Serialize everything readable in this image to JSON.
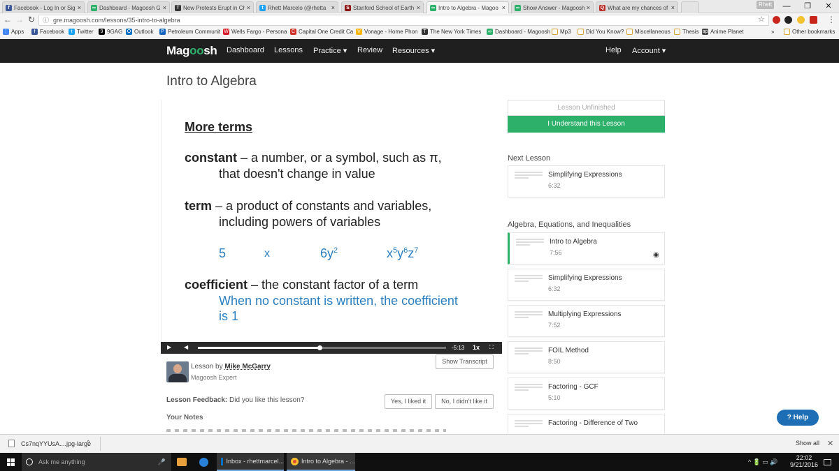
{
  "browser": {
    "tabs": [
      {
        "label": "Facebook - Log In or Sig",
        "color": "#3b5998",
        "glyph": "f"
      },
      {
        "label": "Dashboard - Magoosh G",
        "color": "#2db06a",
        "glyph": "∞"
      },
      {
        "label": "New Protests Erupt in Ch",
        "color": "#333333",
        "glyph": "T"
      },
      {
        "label": "Rhett Marcelo (@rhetta",
        "color": "#1da1f2",
        "glyph": "t"
      },
      {
        "label": "Stanford School of Earth",
        "color": "#8c1515",
        "glyph": "S"
      },
      {
        "label": "Intro to Algebra - Magoo",
        "color": "#2db06a",
        "glyph": "∞"
      },
      {
        "label": "Show Answer - Magoosh",
        "color": "#2db06a",
        "glyph": "∞"
      },
      {
        "label": "What are my chances of",
        "color": "#b92b27",
        "glyph": "Q"
      }
    ],
    "tab_close": "×",
    "user": "Rhett",
    "window_controls": [
      "—",
      "❐",
      "✕"
    ],
    "url": "gre.magoosh.com/lessons/35-intro-to-algebra",
    "bookmarks": [
      {
        "label": "Apps",
        "color": "#4285f4",
        "glyph": "⋮"
      },
      {
        "label": "Facebook",
        "color": "#3b5998",
        "glyph": "f"
      },
      {
        "label": "Twitter",
        "color": "#1da1f2",
        "glyph": "t"
      },
      {
        "label": "9GAG",
        "color": "#000000",
        "glyph": "9"
      },
      {
        "label": "Outlook",
        "color": "#0072c6",
        "glyph": "O"
      },
      {
        "label": "Petroleum Communit",
        "color": "#1565c0",
        "glyph": "P"
      },
      {
        "label": "Wells Fargo - Persona",
        "color": "#d71e28",
        "glyph": "W"
      },
      {
        "label": "Capital One Credit Ca",
        "color": "#d03027",
        "glyph": "C"
      },
      {
        "label": "Vonage - Home Phon",
        "color": "#ffb400",
        "glyph": "V"
      },
      {
        "label": "The New York Times",
        "color": "#333333",
        "glyph": "T"
      },
      {
        "label": "Dashboard - Magoosh",
        "color": "#2db06a",
        "glyph": "∞"
      },
      {
        "label": "Mp3",
        "color": "folder",
        "glyph": ""
      },
      {
        "label": "Did You Know?",
        "color": "folder",
        "glyph": ""
      },
      {
        "label": "Miscellaneous",
        "color": "folder",
        "glyph": ""
      },
      {
        "label": "Thesis",
        "color": "folder",
        "glyph": ""
      },
      {
        "label": "Anime Planet",
        "color": "#444444",
        "glyph": "ap"
      }
    ],
    "bookmarks_more": "»",
    "other_bookmarks": "Other bookmarks"
  },
  "site": {
    "logo_a": "Mag",
    "logo_b": "oo",
    "logo_c": "sh",
    "nav": [
      "Dashboard",
      "Lessons",
      "Practice ▾",
      "Review",
      "Resources ▾"
    ],
    "help": "Help",
    "account": "Account ▾"
  },
  "page_title": "Intro to Algebra",
  "slide": {
    "heading": "More terms",
    "constant_term": "constant",
    "constant_def_1": " – a number, or a symbol, such as π,",
    "constant_def_2": "that doesn't change in value",
    "term_term": "term",
    "term_def_1": " – a product of constants and variables,",
    "term_def_2": "including powers of variables",
    "ex1": "5",
    "ex2": "x",
    "ex3_base": "6y",
    "ex3_exp": "2",
    "ex4_a": "x",
    "ex4_ae": "5",
    "ex4_b": "y",
    "ex4_be": "6",
    "ex4_c": "z",
    "ex4_ce": "7",
    "coef_term": "coefficient",
    "coef_def": " – the constant factor of a term",
    "coef_note_1": "When no constant is written, the coefficient",
    "coef_note_2": "is 1"
  },
  "player": {
    "play": "▶",
    "volume": "◀",
    "time": "-5:13",
    "speed": "1x",
    "fullscreen": "⛶",
    "progress": 0.49
  },
  "transcript_btn": "Show Transcript",
  "author": {
    "prefix": "Lesson by",
    "name": "Mike McGarry",
    "role": "Magoosh Expert"
  },
  "feedback": {
    "label": "Lesson Feedback:",
    "question": "Did you like this lesson?",
    "yes": "Yes, I liked it",
    "no": "No, I didn't like it"
  },
  "notes_label": "Your Notes",
  "sidebar": {
    "status": "Lesson Unfinished",
    "understand": "I Understand this Lesson",
    "next_heading": "Next Lesson",
    "next": {
      "title": "Simplifying Expressions",
      "duration": "6:32"
    },
    "section": "Algebra, Equations, and Inequalities",
    "lessons": [
      {
        "title": "Intro to Algebra",
        "duration": "7:56"
      },
      {
        "title": "Simplifying Expressions",
        "duration": "6:32"
      },
      {
        "title": "Multiplying Expressions",
        "duration": "7:52"
      },
      {
        "title": "FOIL Method",
        "duration": "8:50"
      },
      {
        "title": "Factoring - GCF",
        "duration": "5:10"
      },
      {
        "title": "Factoring - Difference of Two",
        "duration": ""
      }
    ],
    "watched_icon": "◉"
  },
  "help_button": "? Help",
  "downloads": {
    "file": "Cs7nqYYUsA....jpg-large",
    "caret": "^",
    "show_all": "Show all",
    "close": "✕"
  },
  "taskbar": {
    "search": "Ask me anything",
    "outlook": "Inbox - rhettmarcel...",
    "chrome": "Intro to Algebra - ...",
    "time": "22:02",
    "date": "9/21/2016",
    "tray": "^ 🔋 ▭ 🔊"
  },
  "colors": {
    "accent": "#2db06a",
    "nav_bg": "#1f1f1f",
    "link_blue": "#2a7fc1",
    "help": "#1e6eb5"
  }
}
